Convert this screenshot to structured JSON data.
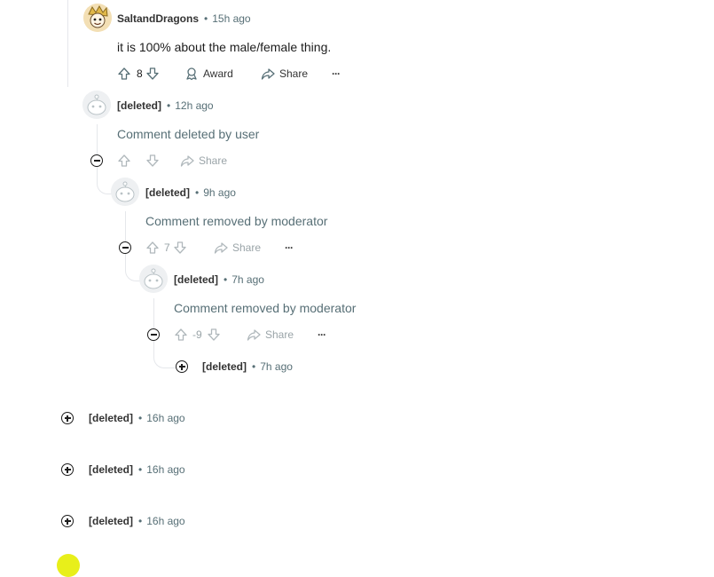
{
  "comments": [
    {
      "author": "SaltandDragons",
      "time": "15h ago",
      "body": "it is 100% about the male/female thing.",
      "score": "8",
      "award_label": "Award",
      "share_label": "Share",
      "more_label": "···"
    },
    {
      "author": "[deleted]",
      "time": "12h ago",
      "body": "Comment deleted by user",
      "share_label": "Share"
    },
    {
      "author": "[deleted]",
      "time": "9h ago",
      "body": "Comment removed by moderator",
      "score": "7",
      "share_label": "Share",
      "more_label": "···"
    },
    {
      "author": "[deleted]",
      "time": "7h ago",
      "body": "Comment removed by moderator",
      "score": "-9",
      "share_label": "Share",
      "more_label": "···"
    }
  ],
  "collapsed": [
    {
      "author": "[deleted]",
      "time": "7h ago"
    },
    {
      "author": "[deleted]",
      "time": "16h ago"
    },
    {
      "author": "[deleted]",
      "time": "16h ago"
    },
    {
      "author": "[deleted]",
      "time": "16h ago"
    }
  ],
  "separator": "•",
  "colors": {
    "text": "#1c1c1c",
    "muted": "#576f76",
    "thread_line": "#e5e7eb",
    "yellow_avatar": "#e8ef1a"
  }
}
